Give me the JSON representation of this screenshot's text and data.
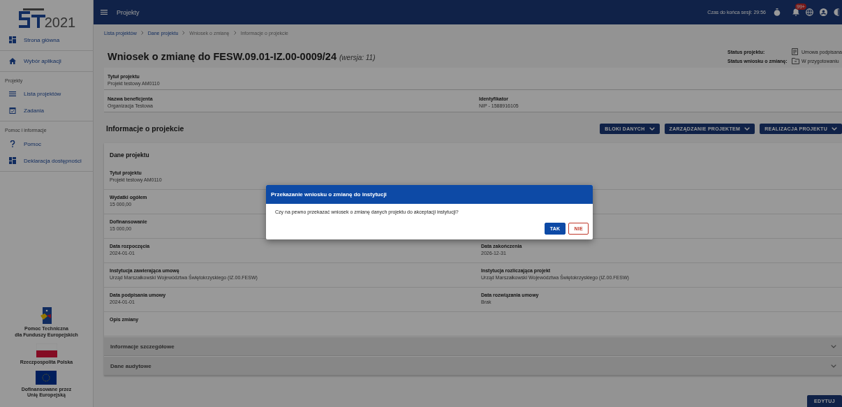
{
  "logo": {
    "year": "2021"
  },
  "sidebar": {
    "groups": [
      {
        "items": [
          {
            "label": "Strona główna"
          }
        ]
      },
      {
        "items": [
          {
            "label": "Wybór aplikacji"
          }
        ]
      },
      {
        "heading": "Projekty",
        "items": [
          {
            "label": "Lista projektów"
          },
          {
            "label": "Zadania"
          }
        ]
      },
      {
        "heading": "Pomoc i informacje",
        "items": [
          {
            "label": "Pomoc"
          },
          {
            "label": "Deklaracja dostępności"
          }
        ]
      }
    ],
    "footer_logos": [
      {
        "kind": "fe",
        "caption": [
          "Pomoc Techniczna",
          "dla Funduszy Europejskich"
        ]
      },
      {
        "kind": "pl",
        "caption": [
          "Rzeczpospolita Polska"
        ]
      },
      {
        "kind": "eu",
        "caption": [
          "Dofinansowane przez",
          "Unię Europejską"
        ]
      }
    ]
  },
  "top_bar": {
    "title": "Projekty",
    "session": "Czas do końca sesji: 29:56",
    "notification_badge": "99+"
  },
  "breadcrumbs": [
    {
      "label": "Lista projektów",
      "link": true
    },
    {
      "label": "Dane projektu",
      "link": true
    },
    {
      "label": "Wniosek o zmianę",
      "link": false
    },
    {
      "label": "Informacje o projekcie",
      "link": false
    }
  ],
  "page_title": {
    "text": "Wniosek o zmianę do FESW.09.01-IZ.00-0009/24",
    "version": "(wersja: 11)"
  },
  "statuses": [
    {
      "label": "Status projektu:",
      "value": "Umowa podpisana"
    },
    {
      "label": "Status wniosku o zmianę:",
      "value": "W przygotowaniu"
    }
  ],
  "summary": [
    [
      {
        "label": "Tytuł projektu",
        "value": "Projekt testowy AM0110"
      }
    ],
    [
      {
        "label": "Nazwa beneficjenta",
        "value": "Organizacja Testowa"
      },
      {
        "label": "Identyfikator",
        "value": "NIP - 1588916105"
      }
    ]
  ],
  "section_title": "Informacje o projekcie",
  "action_buttons": [
    "BLOKI DANYCH",
    "ZARZĄDZANIE PROJEKTEM",
    "REALIZACJA PROJEKTU"
  ],
  "panel": {
    "title": "Dane projektu",
    "rows": [
      [
        {
          "label": "Tytuł projektu",
          "value": "Projekt testowy AM0110"
        }
      ],
      [
        {
          "label": "Wydatki ogółem",
          "value": "15 000,00"
        }
      ],
      [
        {
          "label": "Dofinansowanie",
          "value": "15 000,00"
        }
      ],
      [
        {
          "label": "Data rozpoczęcia",
          "value": "2024-01-01"
        },
        {
          "label": "Data zakończenia",
          "value": "2026-12-31"
        }
      ],
      [
        {
          "label": "Instytucja zawierająca umowę",
          "value": "Urząd Marszałkowski Województwa Świętokrzyskiego (IZ.00.FESW)"
        },
        {
          "label": "Instytucja rozliczająca projekt",
          "value": "Urząd Marszałkowski Województwa Świętokrzyskiego (IZ.00.FESW)"
        }
      ],
      [
        {
          "label": "Data podpisania umowy",
          "value": "2024-01-01"
        },
        {
          "label": "Data rozwiązania umowy",
          "value": "Brak"
        }
      ],
      [
        {
          "label": "Opis zmiany"
        }
      ]
    ]
  },
  "accordions": [
    {
      "label": "Informacje szczegółowe",
      "expanded": false
    },
    {
      "label": "Dane audytowe",
      "expanded": false
    }
  ],
  "edit_button": "EDYTUJ",
  "dialog": {
    "title": "Przekazanie wniosku o zmianę do instytucji",
    "message": "Czy na pewno przekazać wniosek o zmianę danych projektu do akceptacji instytucji?",
    "buttons": [
      {
        "label": "TAK",
        "kind": "primary"
      },
      {
        "label": "NIE",
        "kind": "secondary"
      }
    ]
  }
}
